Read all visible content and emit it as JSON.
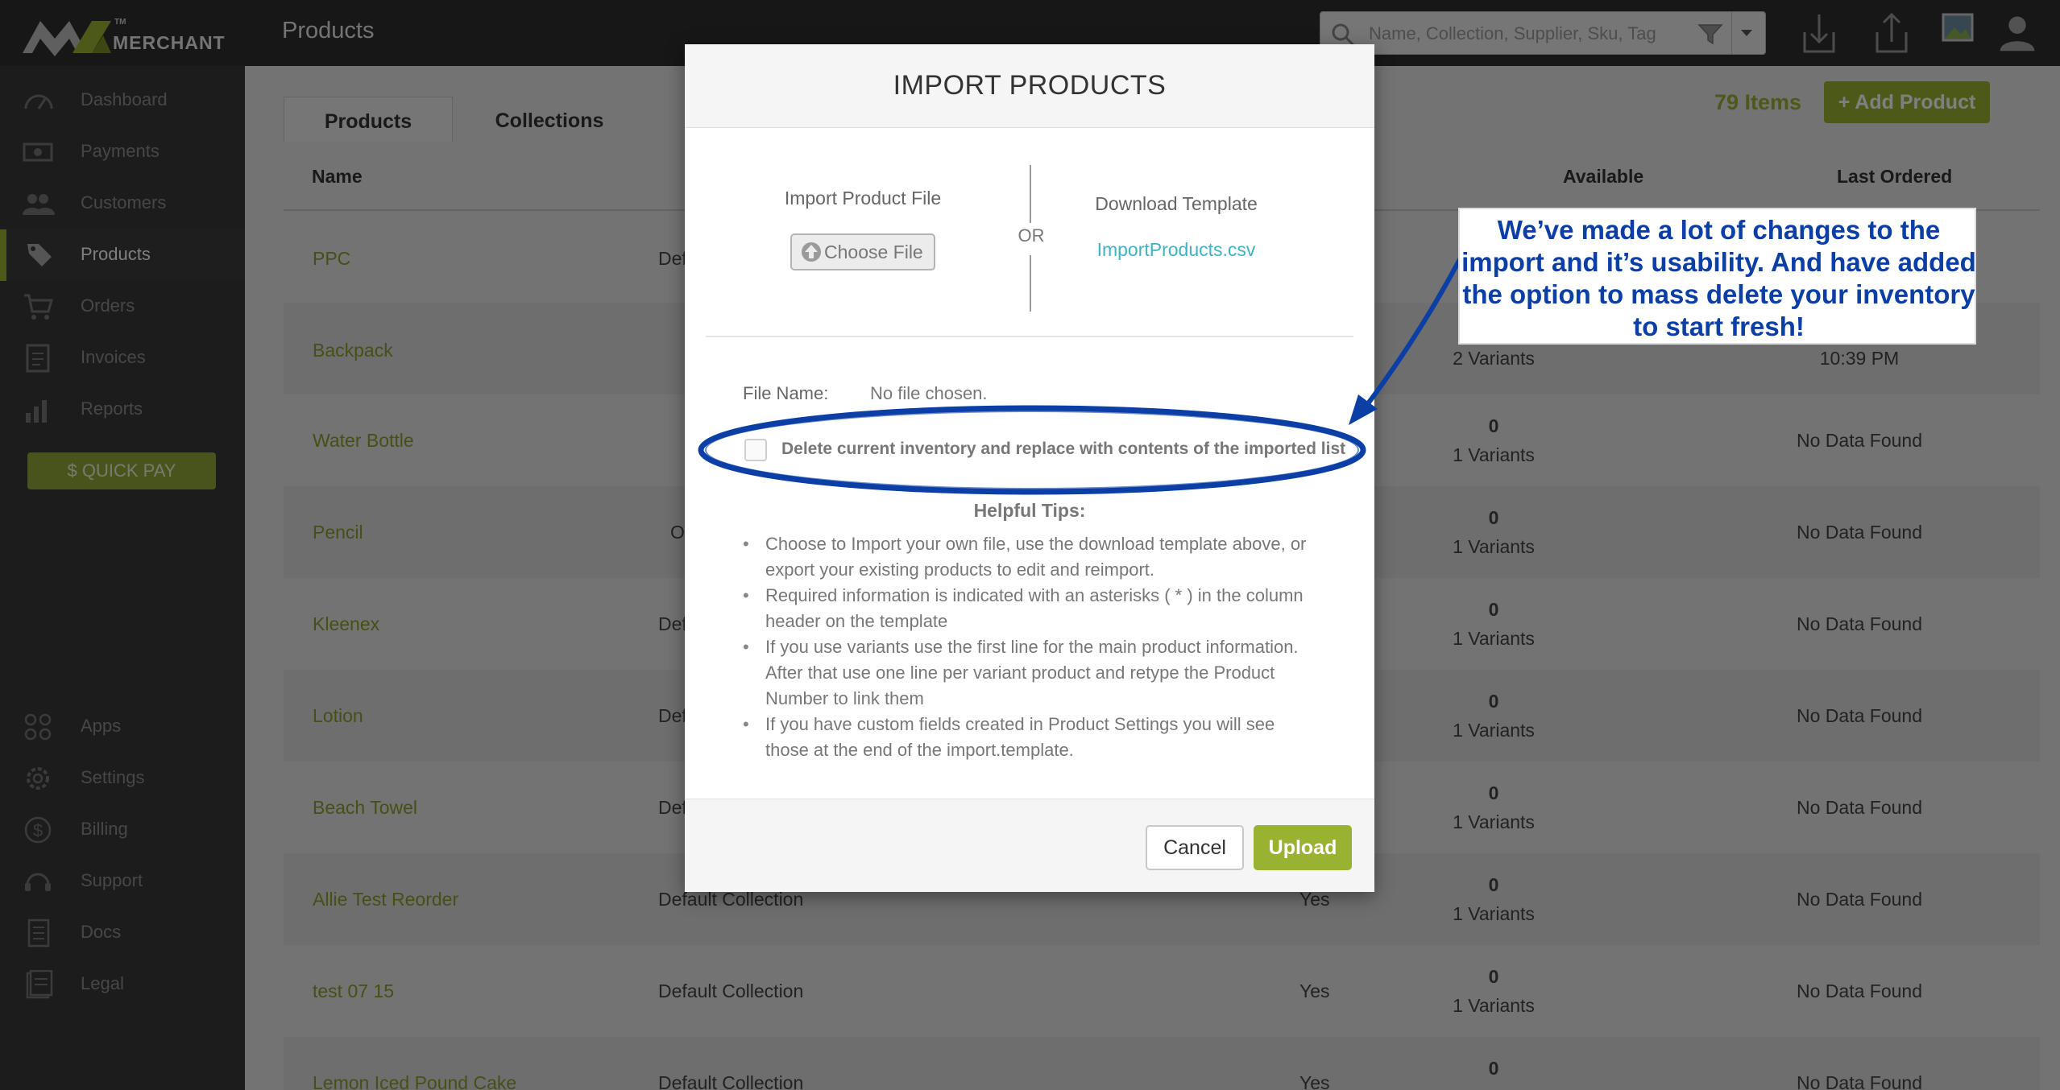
{
  "app": {
    "brand": "MERCHANT",
    "trademark": "TM",
    "page_title": "Products"
  },
  "search": {
    "placeholder": "Name, Collection, Supplier, Sku, Tag"
  },
  "sidebar": {
    "items": [
      {
        "label": "Dashboard",
        "icon": "dashboard-icon"
      },
      {
        "label": "Payments",
        "icon": "payments-icon"
      },
      {
        "label": "Customers",
        "icon": "customers-icon"
      },
      {
        "label": "Products",
        "icon": "tag-icon"
      },
      {
        "label": "Orders",
        "icon": "cart-icon"
      },
      {
        "label": "Invoices",
        "icon": "invoice-icon"
      },
      {
        "label": "Reports",
        "icon": "bar-chart-icon"
      }
    ],
    "quick_pay": "$ QUICK PAY",
    "bottom_items": [
      {
        "label": "Apps",
        "icon": "apps-icon"
      },
      {
        "label": "Settings",
        "icon": "gear-icon"
      },
      {
        "label": "Billing",
        "icon": "dollar-icon"
      },
      {
        "label": "Support",
        "icon": "headset-icon"
      },
      {
        "label": "Docs",
        "icon": "docs-icon"
      },
      {
        "label": "Legal",
        "icon": "legal-icon"
      }
    ]
  },
  "tabs": [
    "Products",
    "Collections"
  ],
  "items_count": "79 Items",
  "add_product": "+ Add Product",
  "table": {
    "headers": {
      "name": "Name",
      "available": "Available",
      "last_ordered": "Last Ordered"
    },
    "rows": [
      {
        "name": "PPC",
        "collection": "Def",
        "available": "",
        "qty": "",
        "variants": "",
        "last": ""
      },
      {
        "name": "Backpack",
        "collection": "",
        "available": "",
        "qty": "",
        "variants": "2 Variants",
        "last": "10:39 PM"
      },
      {
        "name": "Water Bottle",
        "collection": "",
        "available": "",
        "qty": "0",
        "variants": "1 Variants",
        "last": "No Data Found"
      },
      {
        "name": "Pencil",
        "collection": "O",
        "available": "",
        "qty": "0",
        "variants": "1 Variants",
        "last": "No Data Found"
      },
      {
        "name": "Kleenex",
        "collection": "Def",
        "available": "",
        "qty": "0",
        "variants": "1 Variants",
        "last": "No Data Found"
      },
      {
        "name": "Lotion",
        "collection": "Def",
        "available": "",
        "qty": "0",
        "variants": "1 Variants",
        "last": "No Data Found"
      },
      {
        "name": "Beach Towel",
        "collection": "Def",
        "available": "",
        "qty": "0",
        "variants": "1 Variants",
        "last": "No Data Found"
      },
      {
        "name": "Allie Test Reorder",
        "collection": "Default Collection",
        "available": "Yes",
        "qty": "0",
        "variants": "1 Variants",
        "last": "No Data Found"
      },
      {
        "name": "test 07 15",
        "collection": "Default Collection",
        "available": "Yes",
        "qty": "0",
        "variants": "1 Variants",
        "last": "No Data Found"
      },
      {
        "name": "Lemon Iced Pound Cake",
        "collection": "Default Collection",
        "available": "Yes",
        "qty": "0",
        "variants": "",
        "last": "No Data Found"
      }
    ]
  },
  "modal": {
    "title": "IMPORT PRODUCTS",
    "import_label": "Import Product File",
    "choose_file": "Choose File",
    "or": "OR",
    "download_label": "Download Template",
    "template_link": "ImportProducts.csv",
    "file_name_label": "File Name:",
    "file_name_value": "No file chosen.",
    "delete_checkbox_label": "Delete current inventory and replace with contents of the imported list",
    "tips_title": "Helpful Tips:",
    "tips": [
      "Choose to Import your own file, use the download template above, or export your existing products to edit and reimport.",
      "Required information is indicated with an asterisks ( * ) in the column header on the template",
      "If you use variants use the first line for the main product information. After that use one line per variant product and retype the Product Number to link them",
      "If you have custom fields created in Product Settings you will see those at the end of the import.template."
    ],
    "cancel": "Cancel",
    "upload": "Upload"
  },
  "annotation": {
    "text": "We’ve made a lot of changes to the import and it’s usability. And have added the option to mass delete your inventory to start fresh!",
    "color": "#0b3fa6"
  },
  "colors": {
    "accent": "#9ab232",
    "link": "#3eb3c4",
    "topbar": "#2f2f2f",
    "sidebar": "#393939"
  }
}
